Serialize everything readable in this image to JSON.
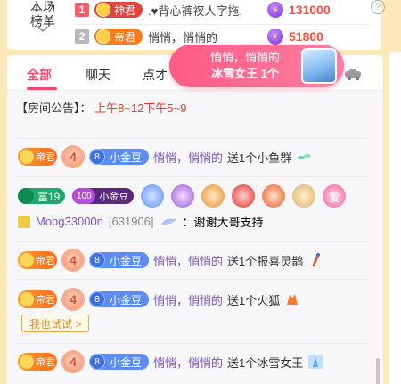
{
  "colors": {
    "accent": "#ff4470",
    "noble_orange": "#ff7a1a",
    "score_red": "#ff4a3d",
    "username_purple": "#7b56c8",
    "fan_blue": "#5b8cf5",
    "announcement_red": "#e8402a",
    "toast_pink": "#ff5a86"
  },
  "ranking": {
    "title_line1": "本场",
    "title_line2": "榜单",
    "rows": [
      {
        "rank": "1",
        "noble": "神君",
        "name": ".♥背心裤衩人字拖.",
        "score": "131000"
      },
      {
        "rank": "2",
        "noble": "帝君",
        "name": "悄悄，悄悄的",
        "score": "51800"
      }
    ],
    "help_icon": "?"
  },
  "tabs": [
    {
      "label": "全部",
      "active": true
    },
    {
      "label": "聊天",
      "active": false
    },
    {
      "label": "点才",
      "active": false
    }
  ],
  "announcement": {
    "prefix": "【房间公告】：",
    "text": "上午8~12下午5~9"
  },
  "toast": {
    "line1": "悄悄，悄悄的",
    "line2": "冰雪女王 1个"
  },
  "messages": [
    {
      "noble": "帝君",
      "level": "4",
      "fan_level": "8",
      "fan_name": "小金豆",
      "user": "悄悄，悄悄的",
      "action": "送1个小鱼群"
    },
    {
      "noble": "帝君",
      "level": "4",
      "fan_level": "8",
      "fan_name": "小金豆",
      "user": "悄悄，悄悄的",
      "action": "送1个报喜灵鹊"
    },
    {
      "noble": "帝君",
      "level": "4",
      "fan_level": "8",
      "fan_name": "小金豆",
      "user": "悄悄，悄悄的",
      "action": "送1个火狐"
    },
    {
      "noble": "帝君",
      "level": "4",
      "fan_level": "8",
      "fan_name": "小金豆",
      "user": "悄悄，悄悄的",
      "action": "送1个冰雪女王"
    }
  ],
  "chat_user": {
    "fu_label": "富19",
    "gold_level": "100",
    "gold_name": "小金豆",
    "love_badge": "爱",
    "name": "Mobg33000n",
    "uid": "[631906]",
    "text": "：谢谢大哥支持"
  },
  "try_button": "我也试试 >"
}
